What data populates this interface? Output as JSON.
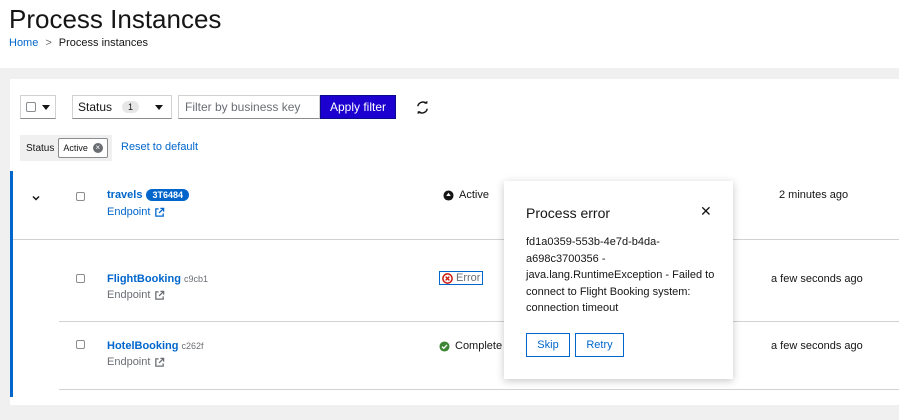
{
  "page": {
    "title": "Process Instances",
    "breadcrumb": {
      "home": "Home",
      "separator": ">",
      "current": "Process instances"
    }
  },
  "toolbar": {
    "status_label": "Status",
    "status_count": "1",
    "filter_placeholder": "Filter by business key",
    "apply_label": "Apply filter"
  },
  "chips": {
    "category": "Status",
    "active_chip": "Active",
    "reset_label": "Reset to default"
  },
  "rows": [
    {
      "name": "travels",
      "badge": "3T6484",
      "endpoint": "Endpoint",
      "state": "Active",
      "time": "2 minutes ago"
    },
    {
      "name": "FlightBooking",
      "short_id": "c9cb1",
      "endpoint": "Endpoint",
      "state": "Error",
      "time": "a few seconds ago"
    },
    {
      "name": "HotelBooking",
      "short_id": "c262f",
      "endpoint": "Endpoint",
      "state": "Complete",
      "time": "a few seconds ago"
    }
  ],
  "popover": {
    "title": "Process error",
    "body": "fd1a0359-553b-4e7d-b4da-a698c3700356 - java.lang.RuntimeException - Failed to connect to Flight Booking system: connection timeout",
    "skip_label": "Skip",
    "retry_label": "Retry"
  },
  "colors": {
    "primary_button": "#1b00d0",
    "link": "#0066cc",
    "success": "#3e8635",
    "danger": "#c9190b"
  }
}
